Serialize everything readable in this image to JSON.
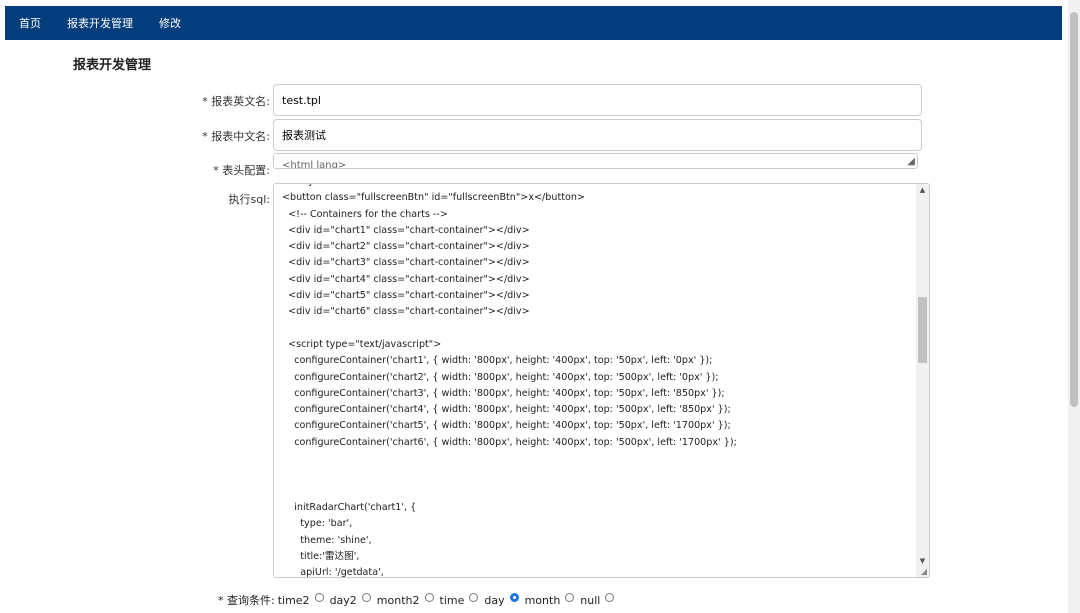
{
  "nav": {
    "items": [
      "首页",
      "报表开发管理",
      "修改"
    ]
  },
  "page_title": "报表开发管理",
  "form": {
    "en_name_label": "* 报表英文名:",
    "en_name_value": "test.tpl",
    "cn_name_label": "* 报表中文名:",
    "cn_name_value": "报表测试",
    "header_label": "* 表头配置:",
    "header_value": "<html lang>",
    "sql_label": "执行sql:",
    "sql_lines": [
      "<body>",
      "<button class=\"fullscreenBtn\" id=\"fullscreenBtn\">x</button>",
      "  <!-- Containers for the charts -->",
      "  <div id=\"chart1\" class=\"chart-container\"></div>",
      "  <div id=\"chart2\" class=\"chart-container\"></div>",
      "  <div id=\"chart3\" class=\"chart-container\"></div>",
      "  <div id=\"chart4\" class=\"chart-container\"></div>",
      "  <div id=\"chart5\" class=\"chart-container\"></div>",
      "  <div id=\"chart6\" class=\"chart-container\"></div>",
      "",
      "  <script type=\"text/javascript\">",
      "    configureContainer('chart1', { width: '800px', height: '400px', top: '50px', left: '0px' });",
      "    configureContainer('chart2', { width: '800px', height: '400px', top: '500px', left: '0px' });",
      "    configureContainer('chart3', { width: '800px', height: '400px', top: '50px', left: '850px' });",
      "    configureContainer('chart4', { width: '800px', height: '400px', top: '500px', left: '850px' });",
      "    configureContainer('chart5', { width: '800px', height: '400px', top: '50px', left: '1700px' });",
      "    configureContainer('chart6', { width: '800px', height: '400px', top: '500px', left: '1700px' });",
      "",
      "",
      "",
      "    initRadarChart('chart1', {",
      "      type: 'bar',",
      "      theme: 'shine',",
      "      title:'雷达图',",
      "      apiUrl: '/getdata',"
    ],
    "query_label": "* 查询条件:",
    "query_options": [
      {
        "label": "time2",
        "checked": false
      },
      {
        "label": "day2",
        "checked": false
      },
      {
        "label": "month2",
        "checked": false
      },
      {
        "label": "time",
        "checked": false
      },
      {
        "label": "day",
        "checked": true
      },
      {
        "label": "month",
        "checked": false
      },
      {
        "label": "null",
        "checked": false
      }
    ]
  }
}
